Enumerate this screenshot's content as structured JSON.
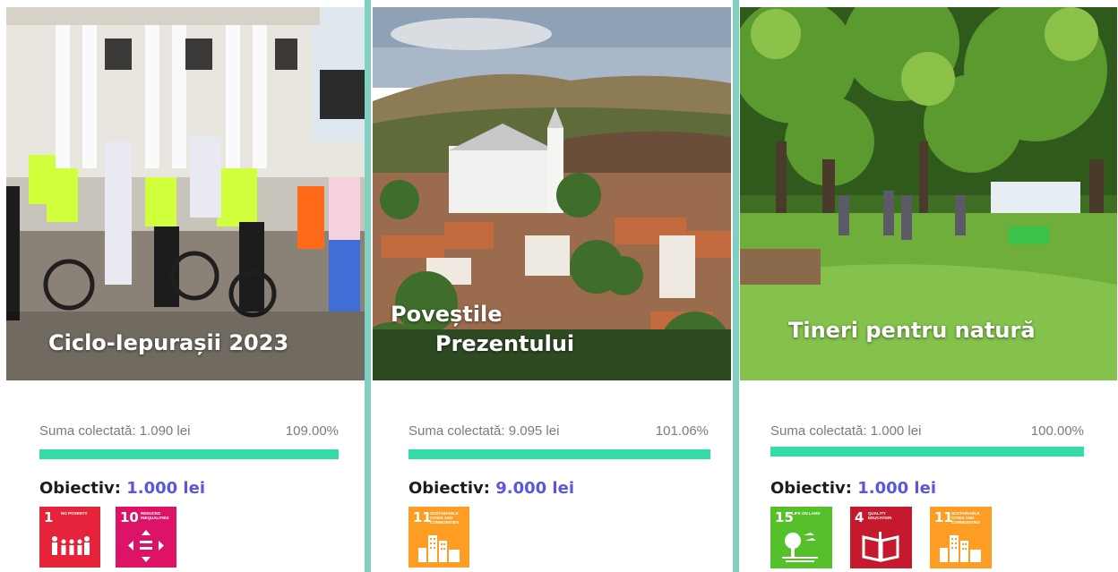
{
  "cards": [
    {
      "title": "Ciclo-Iepurașii 2023",
      "raised_label": "Suma colectată: 1.090 lei",
      "raised_percent": "109.00%",
      "progress": 1.0,
      "objective_label": "Obiectiv:",
      "objective_value": "1.000 lei",
      "sdgs": [
        {
          "number": "1",
          "text": "NO POVERTY",
          "color": "#e5243b",
          "icon": "family-icon"
        },
        {
          "number": "10",
          "text": "REDUCED INEQUALITIES",
          "color": "#dd1367",
          "icon": "equality-icon"
        }
      ]
    },
    {
      "title_line1": "Poveștile",
      "title_line2": "Prezentului",
      "raised_label": "Suma colectată: 9.095 lei",
      "raised_percent": "101.06%",
      "progress": 1.0,
      "objective_label": "Obiectiv:",
      "objective_value": "9.000 lei",
      "sdgs": [
        {
          "number": "11",
          "text": "SUSTAINABLE CITIES AND COMMUNITIES",
          "color": "#fd9d24",
          "icon": "city-icon"
        }
      ]
    },
    {
      "title": "Tineri pentru natură",
      "raised_label": "Suma colectată: 1.000 lei",
      "raised_percent": "100.00%",
      "progress": 1.0,
      "objective_label": "Obiectiv:",
      "objective_value": "1.000 lei",
      "sdgs": [
        {
          "number": "15",
          "text": "LIFE ON LAND",
          "color": "#56c02b",
          "icon": "tree-icon"
        },
        {
          "number": "4",
          "text": "QUALITY EDUCATION",
          "color": "#c5192d",
          "icon": "book-icon"
        },
        {
          "number": "11",
          "text": "SUSTAINABLE CITIES AND COMMUNITIES",
          "color": "#fd9d24",
          "icon": "city-icon"
        }
      ]
    }
  ],
  "colors": {
    "accent_bar": "#35dba9",
    "objective_value": "#5b55e0",
    "divider": "#7fd0c0"
  }
}
